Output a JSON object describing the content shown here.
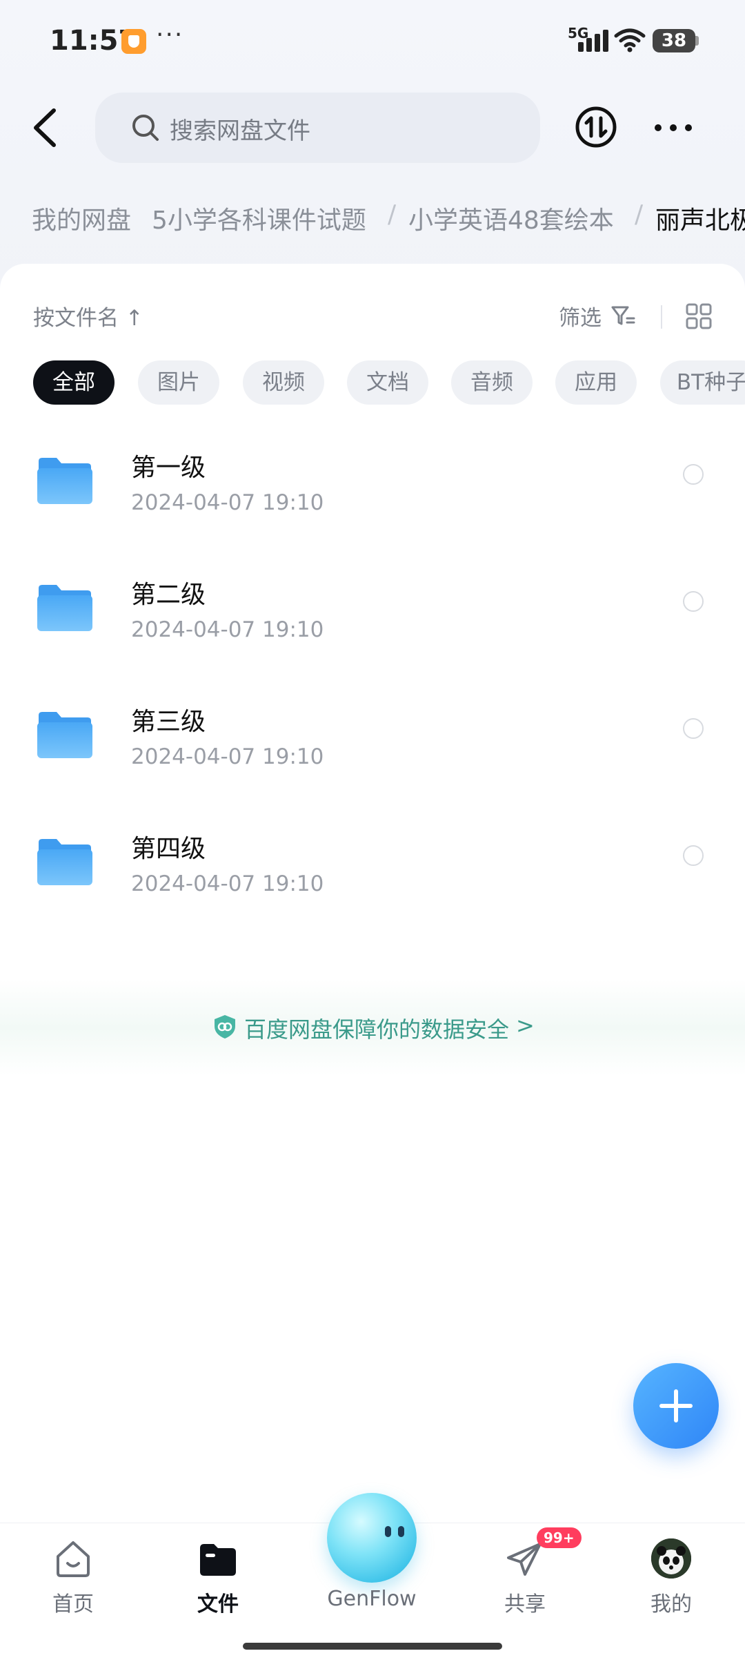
{
  "status_bar": {
    "time": "11:57",
    "dots": "···",
    "network": "5G",
    "battery": "38"
  },
  "header": {
    "search_placeholder": "搜索网盘文件"
  },
  "breadcrumb": [
    {
      "label": "我的网盘",
      "current": false
    },
    {
      "label": "5小学各科课件试题",
      "current": false
    },
    {
      "label": "小学英语48套绘本",
      "current": false
    },
    {
      "label": "丽声北极",
      "current": true
    }
  ],
  "breadcrumb_separator": "/",
  "toolbar": {
    "sort_label": "按文件名 ↑",
    "filter_label": "筛选"
  },
  "chips": [
    {
      "label": "全部",
      "active": true
    },
    {
      "label": "图片",
      "active": false
    },
    {
      "label": "视频",
      "active": false
    },
    {
      "label": "文档",
      "active": false
    },
    {
      "label": "音频",
      "active": false
    },
    {
      "label": "应用",
      "active": false
    },
    {
      "label": "BT种子",
      "active": false
    }
  ],
  "files": [
    {
      "name": "第一级",
      "date": "2024-04-07  19:10"
    },
    {
      "name": "第二级",
      "date": "2024-04-07  19:10"
    },
    {
      "name": "第三级",
      "date": "2024-04-07  19:10"
    },
    {
      "name": "第四级",
      "date": "2024-04-07  19:10"
    }
  ],
  "security_banner": {
    "text": "百度网盘保障你的数据安全",
    "arrow": ">"
  },
  "tabs": [
    {
      "label": "首页",
      "active": false
    },
    {
      "label": "文件",
      "active": true
    },
    {
      "label": "GenFlow",
      "active": false
    },
    {
      "label": "共享",
      "active": false
    },
    {
      "label": "我的",
      "active": false
    }
  ],
  "share_badge": "99+",
  "colors": {
    "accent": "#2f86f7",
    "active_chip": "#0e1117",
    "security": "#3a9a8a",
    "badge": "#ff3d5e"
  }
}
